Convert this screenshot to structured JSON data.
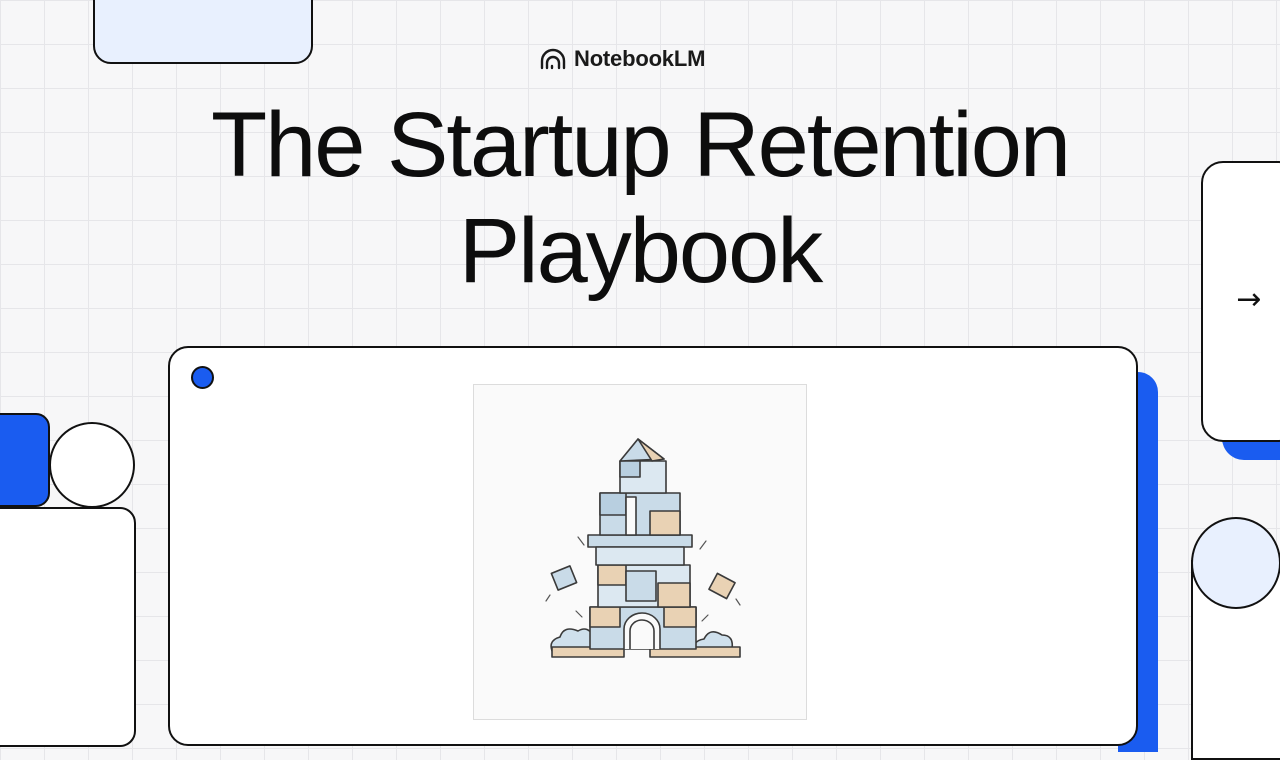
{
  "brand": {
    "name": "NotebookLM",
    "logo_icon": "notebooklm-logo-icon"
  },
  "title": {
    "line1": "The Startup Retention",
    "line2": "Playbook"
  },
  "navigation": {
    "next_icon": "arrow-right-icon",
    "next_glyph": "→"
  },
  "illustration": {
    "subject": "crumbling-block-tower-illustration"
  },
  "colors": {
    "accent": "#1a5cf0",
    "light_blue": "#e8f0fe",
    "outline": "#111111",
    "background": "#f7f7f8"
  }
}
